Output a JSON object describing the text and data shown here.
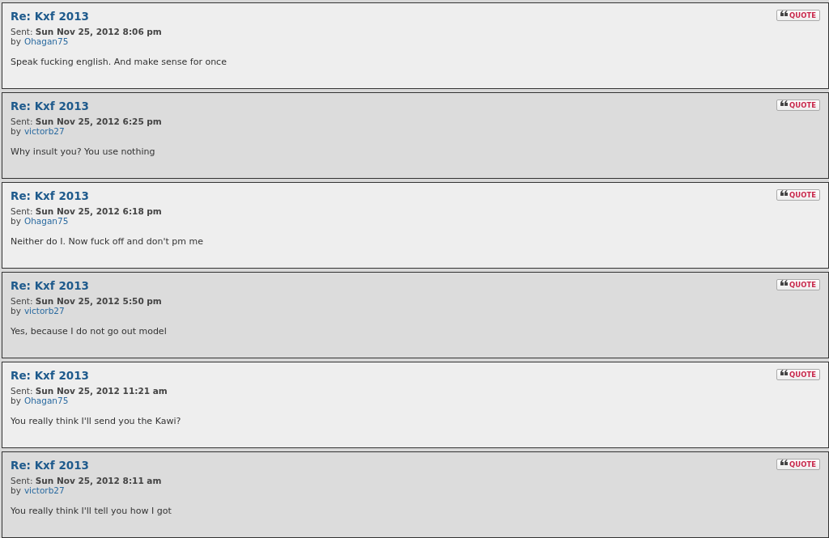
{
  "posts": [
    {
      "title": "Re: Kxf 2013",
      "sent": "Sent: **Sun Nov 25, 2012 8:06 pm**",
      "by": "by",
      "author": "Ohagan75",
      "message": "Speak fucking english. And make sense for once",
      "quote": "QUOTE"
    },
    {
      "title": "Re: Kxf 2013",
      "sent": "Sent: **Sun Nov 25, 2012 6:25 pm**",
      "by": "by",
      "author": "victorb27",
      "message": "Why insult you? You use nothing",
      "quote": "QUOTE"
    },
    {
      "title": "Re: Kxf 2013",
      "sent": "Sent: **Sun Nov 25, 2012 6:18 pm**",
      "by": "by",
      "author": "Ohagan75",
      "message": "Neither do I. Now fuck off and don't pm me",
      "quote": "QUOTE"
    },
    {
      "title": "Re: Kxf 2013",
      "sent": "Sent: **Sun Nov 25, 2012 5:50 pm**",
      "by": "by",
      "author": "victorb27",
      "message": "Yes, because I do not go out model",
      "quote": "QUOTE"
    },
    {
      "title": "Re: Kxf 2013",
      "sent": "Sent: **Sun Nov 25, 2012 11:21 am**",
      "by": "by",
      "author": "Ohagan75",
      "message": "You really think I'll send you the Kawi?",
      "quote": "QUOTE"
    },
    {
      "title": "Re: Kxf 2013",
      "sent": "Sent: **Sun Nov 25, 2012 8:11 am**",
      "by": "by",
      "author": "victorb27",
      "message": "You really think I'll tell you how I got",
      "quote": "QUOTE"
    }
  ]
}
